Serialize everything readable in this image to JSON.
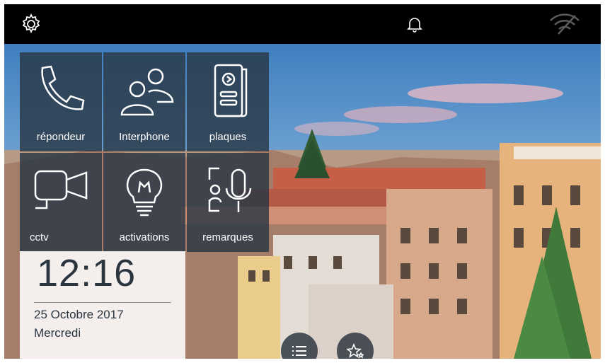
{
  "topbar": {
    "settings_icon": "gear-icon",
    "notification_icon": "bell-icon",
    "wifi_icon": "wifi-off-icon"
  },
  "tiles": [
    {
      "label": "répondeur",
      "icon": "phone-icon"
    },
    {
      "label": "Interphone",
      "icon": "users-icon"
    },
    {
      "label": "plaques",
      "icon": "door-panel-icon"
    },
    {
      "label": "cctv",
      "icon": "camera-icon"
    },
    {
      "label": "activations",
      "icon": "bulb-icon"
    },
    {
      "label": "remarques",
      "icon": "voice-note-icon"
    }
  ],
  "clock": {
    "time": "12:16",
    "date": "25 Octobre 2017",
    "day": "Mercredi"
  },
  "bottom_buttons": [
    {
      "icon": "list-icon"
    },
    {
      "icon": "favorite-stars-icon"
    }
  ],
  "colors": {
    "tile_bg": "#28374480",
    "topbar_bg": "#000000",
    "sky": "#5b90c4"
  }
}
